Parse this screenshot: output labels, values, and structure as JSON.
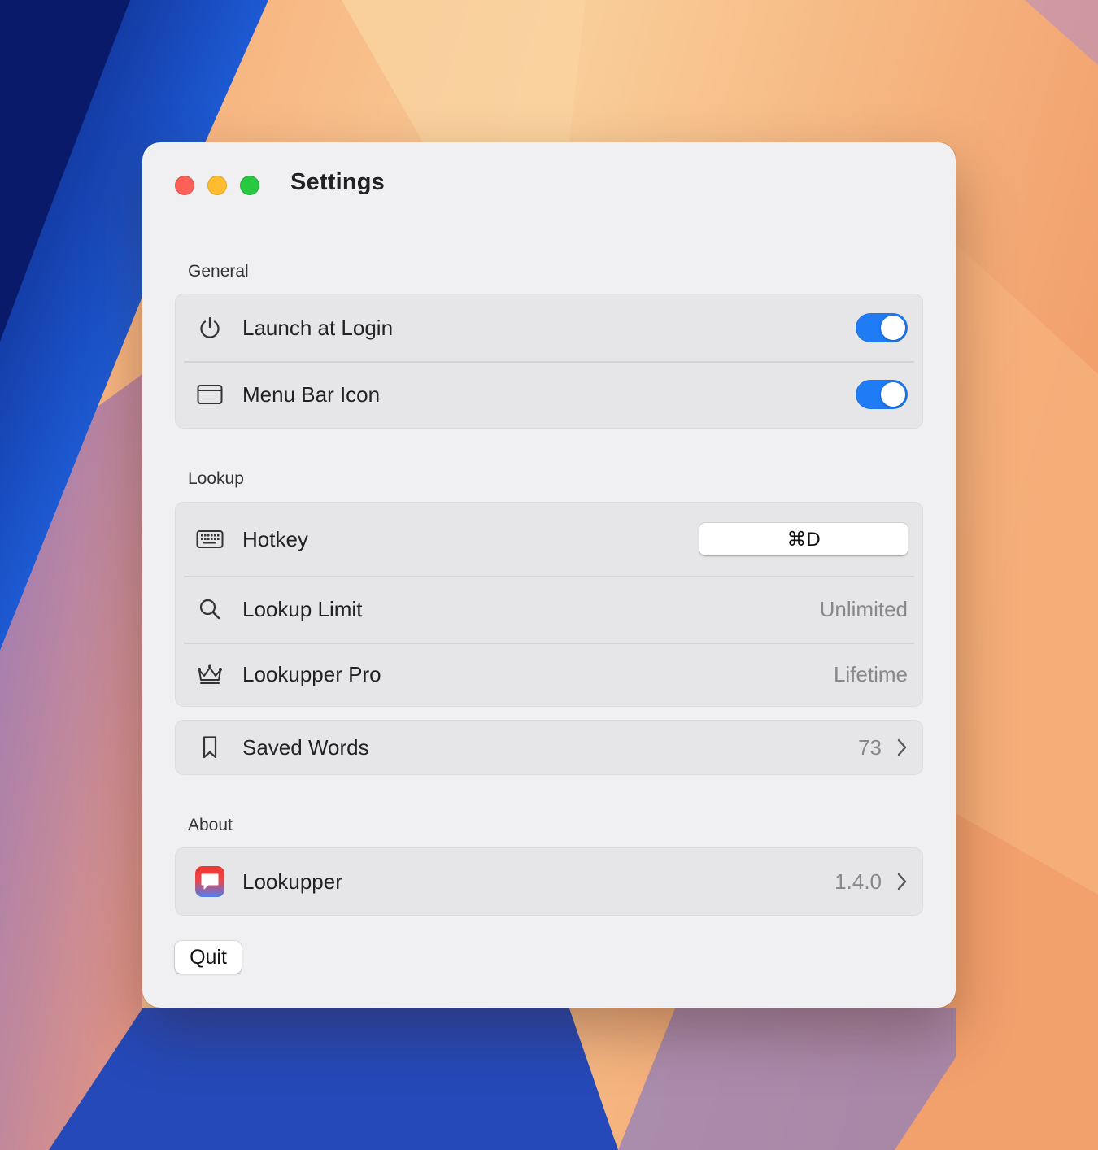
{
  "window": {
    "title": "Settings",
    "traffic_lights": {
      "close": "#fe5f57",
      "minimize": "#febc2e",
      "zoom": "#28c840"
    }
  },
  "sections": {
    "general": {
      "label": "General",
      "launch_at_login": {
        "label": "Launch at Login",
        "icon": "power-icon",
        "enabled": true
      },
      "menu_bar_icon": {
        "label": "Menu Bar Icon",
        "icon": "window-icon",
        "enabled": true
      }
    },
    "lookup": {
      "label": "Lookup",
      "hotkey": {
        "label": "Hotkey",
        "icon": "keyboard-icon",
        "value": "⌘D"
      },
      "lookup_limit": {
        "label": "Lookup Limit",
        "icon": "magnifier-icon",
        "value": "Unlimited"
      },
      "lookupper_pro": {
        "label": "Lookupper Pro",
        "icon": "crown-icon",
        "value": "Lifetime"
      }
    },
    "saved": {
      "label": "Saved Words",
      "icon": "bookmark-icon",
      "value": "73"
    },
    "about": {
      "label": "About",
      "app": {
        "label": "Lookupper",
        "icon": "app-icon",
        "value": "1.4.0"
      }
    }
  },
  "quit_label": "Quit",
  "accent_color": "#1f7cf5"
}
